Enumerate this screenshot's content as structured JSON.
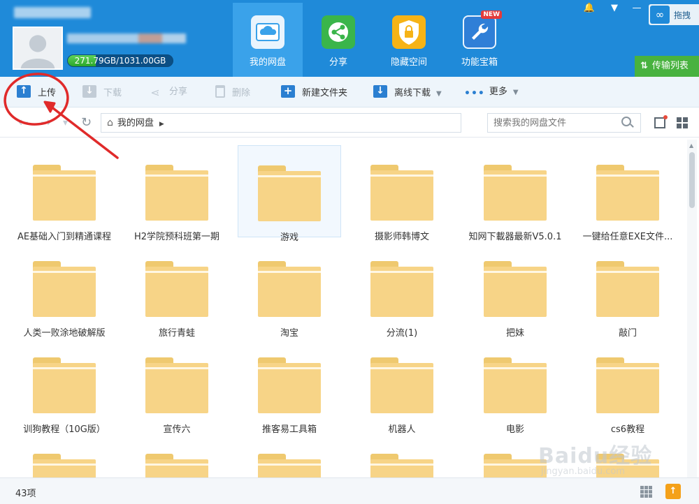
{
  "header": {
    "quota": {
      "text": "271.79GB/1031.00GB",
      "used_fraction": 0.2636
    },
    "nav": [
      {
        "label": "我的网盘",
        "icon": "cloud-drive-icon",
        "active": true
      },
      {
        "label": "分享",
        "icon": "share-icon",
        "active": false
      },
      {
        "label": "隐藏空间",
        "icon": "lock-icon",
        "active": false
      },
      {
        "label": "功能宝箱",
        "icon": "toolbox-icon",
        "active": false,
        "badge": "NEW"
      }
    ],
    "tray_label": "拖拽",
    "transfer_label": "传输列表"
  },
  "toolbar": {
    "upload": "上传",
    "download": "下载",
    "share": "分享",
    "delete": "删除",
    "new_folder": "新建文件夹",
    "offline": "离线下载",
    "more": "更多"
  },
  "address": {
    "path": "我的网盘",
    "search_placeholder": "搜索我的网盘文件"
  },
  "files": [
    "AE基础入门到精通课程",
    "H2学院预科班第一期",
    "游戏",
    "摄影师韩博文",
    "知网下載器最新V5.0.1",
    "一键给任意EXE文件...",
    "人类一败涂地破解版",
    "旅行青蛙",
    "淘宝",
    "分流(1)",
    "把妹",
    "敲门",
    "训狗教程（10G版）",
    "宣传六",
    "推客易工具箱",
    "机器人",
    "电影",
    "cs6教程",
    "",
    "",
    "",
    "",
    "",
    ""
  ],
  "selected_file_index": 2,
  "status": {
    "count": "43项"
  },
  "watermark": {
    "logo": "Baidu经验",
    "url": "jingyan.baidu.com"
  },
  "colors": {
    "header": "#1f8ad9",
    "folder": "#f7d487",
    "annotation": "#e02a2a"
  }
}
